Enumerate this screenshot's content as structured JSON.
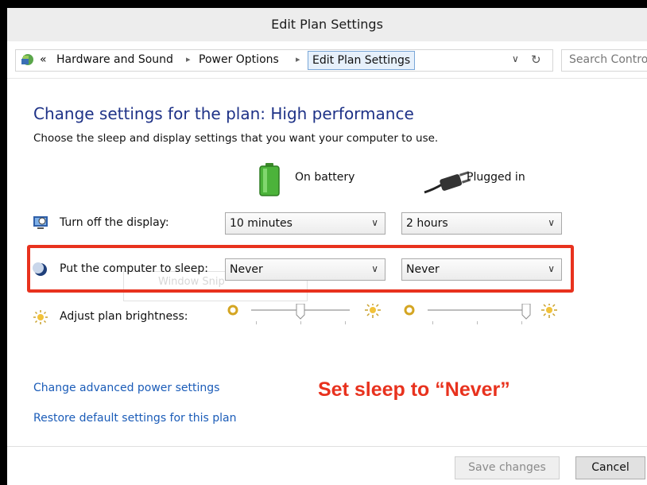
{
  "window": {
    "title": "Edit Plan Settings"
  },
  "address": {
    "overflow": "«",
    "crumbs": [
      "Hardware and Sound",
      "Power Options",
      "Edit Plan Settings"
    ],
    "dropdown_glyph": "∨",
    "refresh_glyph": "↻",
    "search_placeholder": "Search Contro"
  },
  "content": {
    "heading": "Change settings for the plan: High performance",
    "subheading": "Choose the sleep and display settings that you want your computer to use.",
    "columns": {
      "battery": "On battery",
      "plugged": "Plugged in"
    },
    "rows": {
      "display": {
        "label": "Turn off the display:",
        "battery": "10 minutes",
        "plugged": "2 hours",
        "icon": "display-icon"
      },
      "sleep": {
        "label": "Put the computer to sleep:",
        "battery": "Never",
        "plugged": "Never",
        "icon": "moon-icon"
      },
      "brightness": {
        "label": "Adjust plan brightness:",
        "battery_level": 0.5,
        "plugged_level": 1.0,
        "icon": "brightness-icon"
      }
    },
    "ghost_text": "Window Snip",
    "links": {
      "advanced": "Change advanced power settings",
      "restore": "Restore default settings for this plan"
    },
    "annotation": "Set sleep to “Never”"
  },
  "buttons": {
    "save": "Save changes",
    "cancel": "Cancel"
  },
  "colors": {
    "accent": "#1e3287",
    "link": "#1b5cb8",
    "highlight": "#e8321e"
  }
}
